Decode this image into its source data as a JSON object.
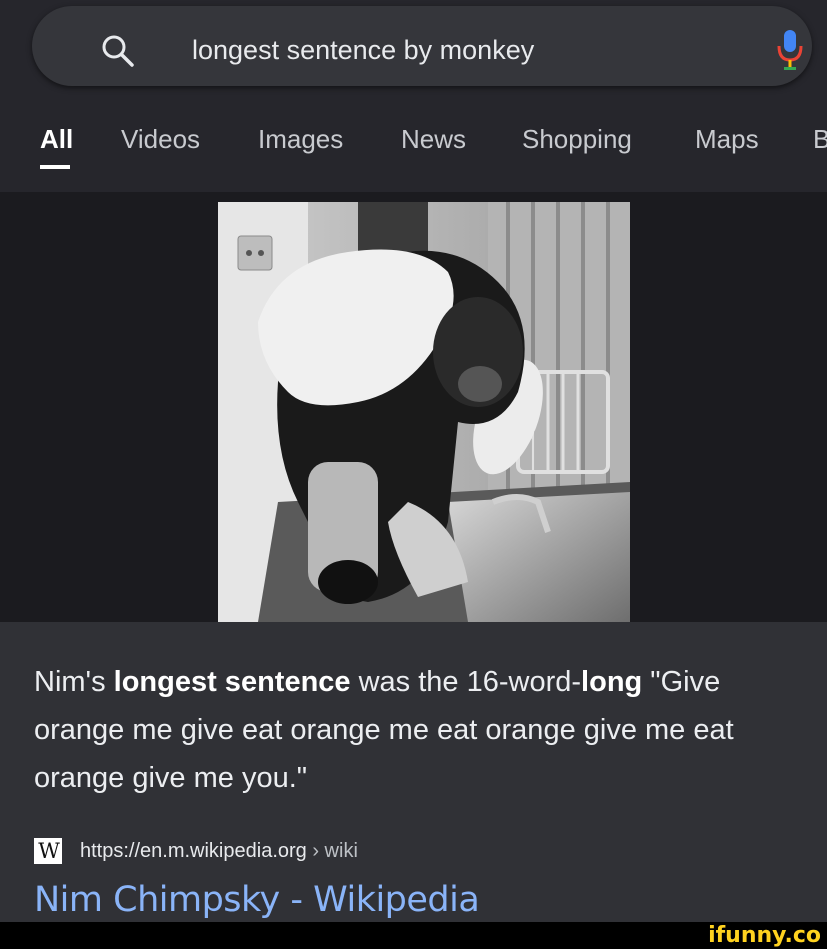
{
  "search": {
    "query": "longest sentence by monkey",
    "icon": "search-icon",
    "mic_icon": "microphone-icon",
    "mic_colors": [
      "#4285f4",
      "#ea4335",
      "#fbbc05",
      "#34a853"
    ]
  },
  "tabs": [
    {
      "label": "All",
      "active": true
    },
    {
      "label": "Videos",
      "active": false
    },
    {
      "label": "Images",
      "active": false
    },
    {
      "label": "News",
      "active": false
    },
    {
      "label": "Shopping",
      "active": false
    },
    {
      "label": "Maps",
      "active": false
    },
    {
      "label": "B",
      "active": false
    }
  ],
  "featured_snippet": {
    "text_parts": [
      {
        "text": "Nim's ",
        "bold": false
      },
      {
        "text": "longest sentence",
        "bold": true
      },
      {
        "text": " was the 16-word-",
        "bold": false
      },
      {
        "text": "long",
        "bold": true
      },
      {
        "text": " \"Give orange me give eat orange me eat orange give me eat orange give me you.\"",
        "bold": false
      }
    ]
  },
  "source": {
    "favicon_letter": "W",
    "url": "https://en.m.wikipedia.org",
    "breadcrumb": " › wiki",
    "title": "Nim Chimpsky - Wikipedia"
  },
  "watermark": "ifunny.co",
  "colors": {
    "background": "#202124",
    "link": "#8ab4f8",
    "watermark": "#ffd21f"
  }
}
